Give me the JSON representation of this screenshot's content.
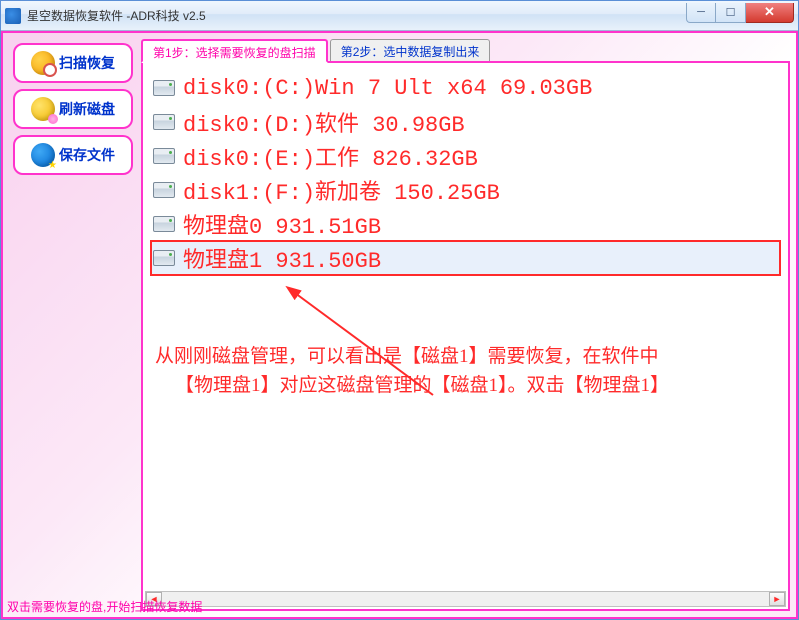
{
  "window": {
    "title": "星空数据恢复软件    -ADR科技 v2.5"
  },
  "sidebar": {
    "buttons": [
      {
        "id": "scan",
        "label": "扫描恢复"
      },
      {
        "id": "refresh",
        "label": "刷新磁盘"
      },
      {
        "id": "save",
        "label": "保存文件"
      }
    ]
  },
  "tabs": [
    {
      "label": "第1步：选择需要恢复的盘扫描",
      "active": true
    },
    {
      "label": "第2步：选中数据复制出来",
      "active": false
    }
  ],
  "disks": [
    {
      "label": "disk0:(C:)Win 7 Ult x64 69.03GB",
      "selected": false
    },
    {
      "label": "disk0:(D:)软件 30.98GB",
      "selected": false
    },
    {
      "label": "disk0:(E:)工作 826.32GB",
      "selected": false
    },
    {
      "label": "disk1:(F:)新加卷 150.25GB",
      "selected": false
    },
    {
      "label": "物理盘0 931.51GB",
      "selected": false
    },
    {
      "label": "物理盘1 931.50GB",
      "selected": true
    }
  ],
  "annotation": {
    "line1": "从刚刚磁盘管理，可以看出是【磁盘1】需要恢复，在软件中",
    "line2": "【物理盘1】对应这磁盘管理的【磁盘1】。双击【物理盘1】"
  },
  "statusbar": {
    "text": "双击需要恢复的盘,开始扫描恢复数据"
  },
  "colors": {
    "accent_pink": "#ff33cc",
    "text_red": "#ff2a2a",
    "text_blue": "#0033cc"
  }
}
